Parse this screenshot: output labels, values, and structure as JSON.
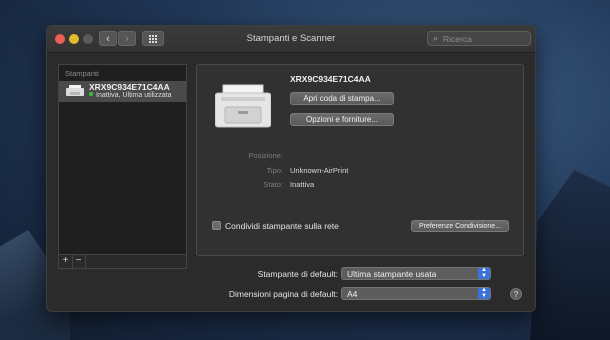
{
  "window": {
    "title": "Stampanti e Scanner"
  },
  "search": {
    "placeholder": "Ricerca"
  },
  "sidebar": {
    "header": "Stampanti",
    "printers": [
      {
        "name": "XRX9C934E71C4AA",
        "status": "Inattiva, Ultima utilizzata",
        "status_color": "#3ac43a"
      }
    ],
    "add_label": "+",
    "remove_label": "−"
  },
  "detail": {
    "printer_name": "XRX9C934E71C4AA",
    "open_queue_label": "Apri coda di stampa...",
    "options_label": "Opzioni e forniture...",
    "position_label": "Posizione:",
    "position_value": "",
    "type_label": "Tipo:",
    "type_value": "Unknown-AirPrint",
    "state_label": "Stato:",
    "state_value": "Inattiva",
    "share_label": "Condividi stampante sulla rete",
    "share_checked": false,
    "share_prefs_label": "Preferenze Condivisione..."
  },
  "defaults": {
    "printer_label": "Stampante di default:",
    "printer_value": "Ultima stampante usata",
    "paper_label": "Dimensioni pagina di default:",
    "paper_value": "A4"
  },
  "help_label": "?",
  "colors": {
    "accent": "#3b72d9",
    "close": "#ec5f57",
    "minimize": "#e0bb2e"
  }
}
